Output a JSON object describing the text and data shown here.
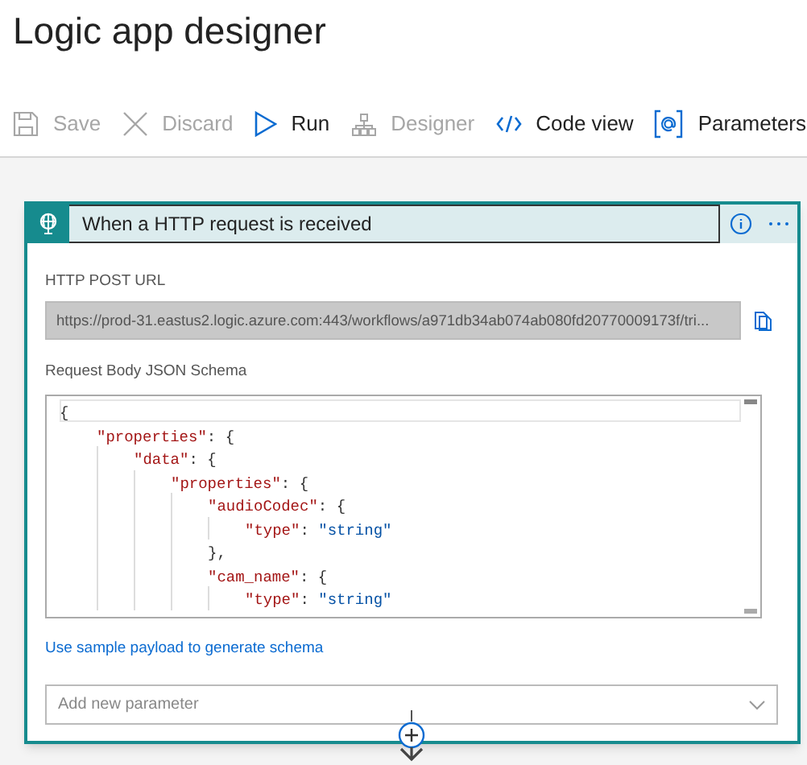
{
  "page_title": "Logic app designer",
  "toolbar": [
    {
      "kind": "save",
      "label": "Save",
      "disabled": true
    },
    {
      "kind": "discard",
      "label": "Discard",
      "disabled": true
    },
    {
      "kind": "run",
      "label": "Run",
      "disabled": false
    },
    {
      "kind": "designer",
      "label": "Designer",
      "disabled": true
    },
    {
      "kind": "code",
      "label": "Code view",
      "disabled": false
    },
    {
      "kind": "parameters",
      "label": "Parameters",
      "disabled": false
    }
  ],
  "trigger_card": {
    "title": "When a HTTP request is received",
    "url_label": "HTTP POST URL",
    "url_value": "https://prod-31.eastus2.logic.azure.com:443/workflows/a971db34ab074ab080fd20770009173f/tri...",
    "schema_label": "Request Body JSON Schema",
    "schema_code": [
      {
        "punct": "{",
        "children": [
          {
            "key": "\"properties\"",
            "punct": ": {",
            "children": [
              {
                "key": "\"data\"",
                "punct": ": {",
                "children": [
                  {
                    "key": "\"properties\"",
                    "punct": ": {",
                    "children": [
                      {
                        "key": "\"audioCodec\"",
                        "punct": ": {",
                        "children": [
                          {
                            "key": "\"type\"",
                            "punct": ": ",
                            "value": "\"string\""
                          }
                        ]
                      },
                      {
                        "punct": "},"
                      },
                      {
                        "key": "\"cam_name\"",
                        "punct": ": {",
                        "children": [
                          {
                            "key": "\"type\"",
                            "punct": ": ",
                            "value": "\"string\""
                          }
                        ]
                      }
                    ]
                  }
                ]
              }
            ]
          }
        ]
      }
    ],
    "sample_link": "Use sample payload to generate schema",
    "parameter_dropdown": {
      "placeholder": "Add new parameter"
    }
  }
}
